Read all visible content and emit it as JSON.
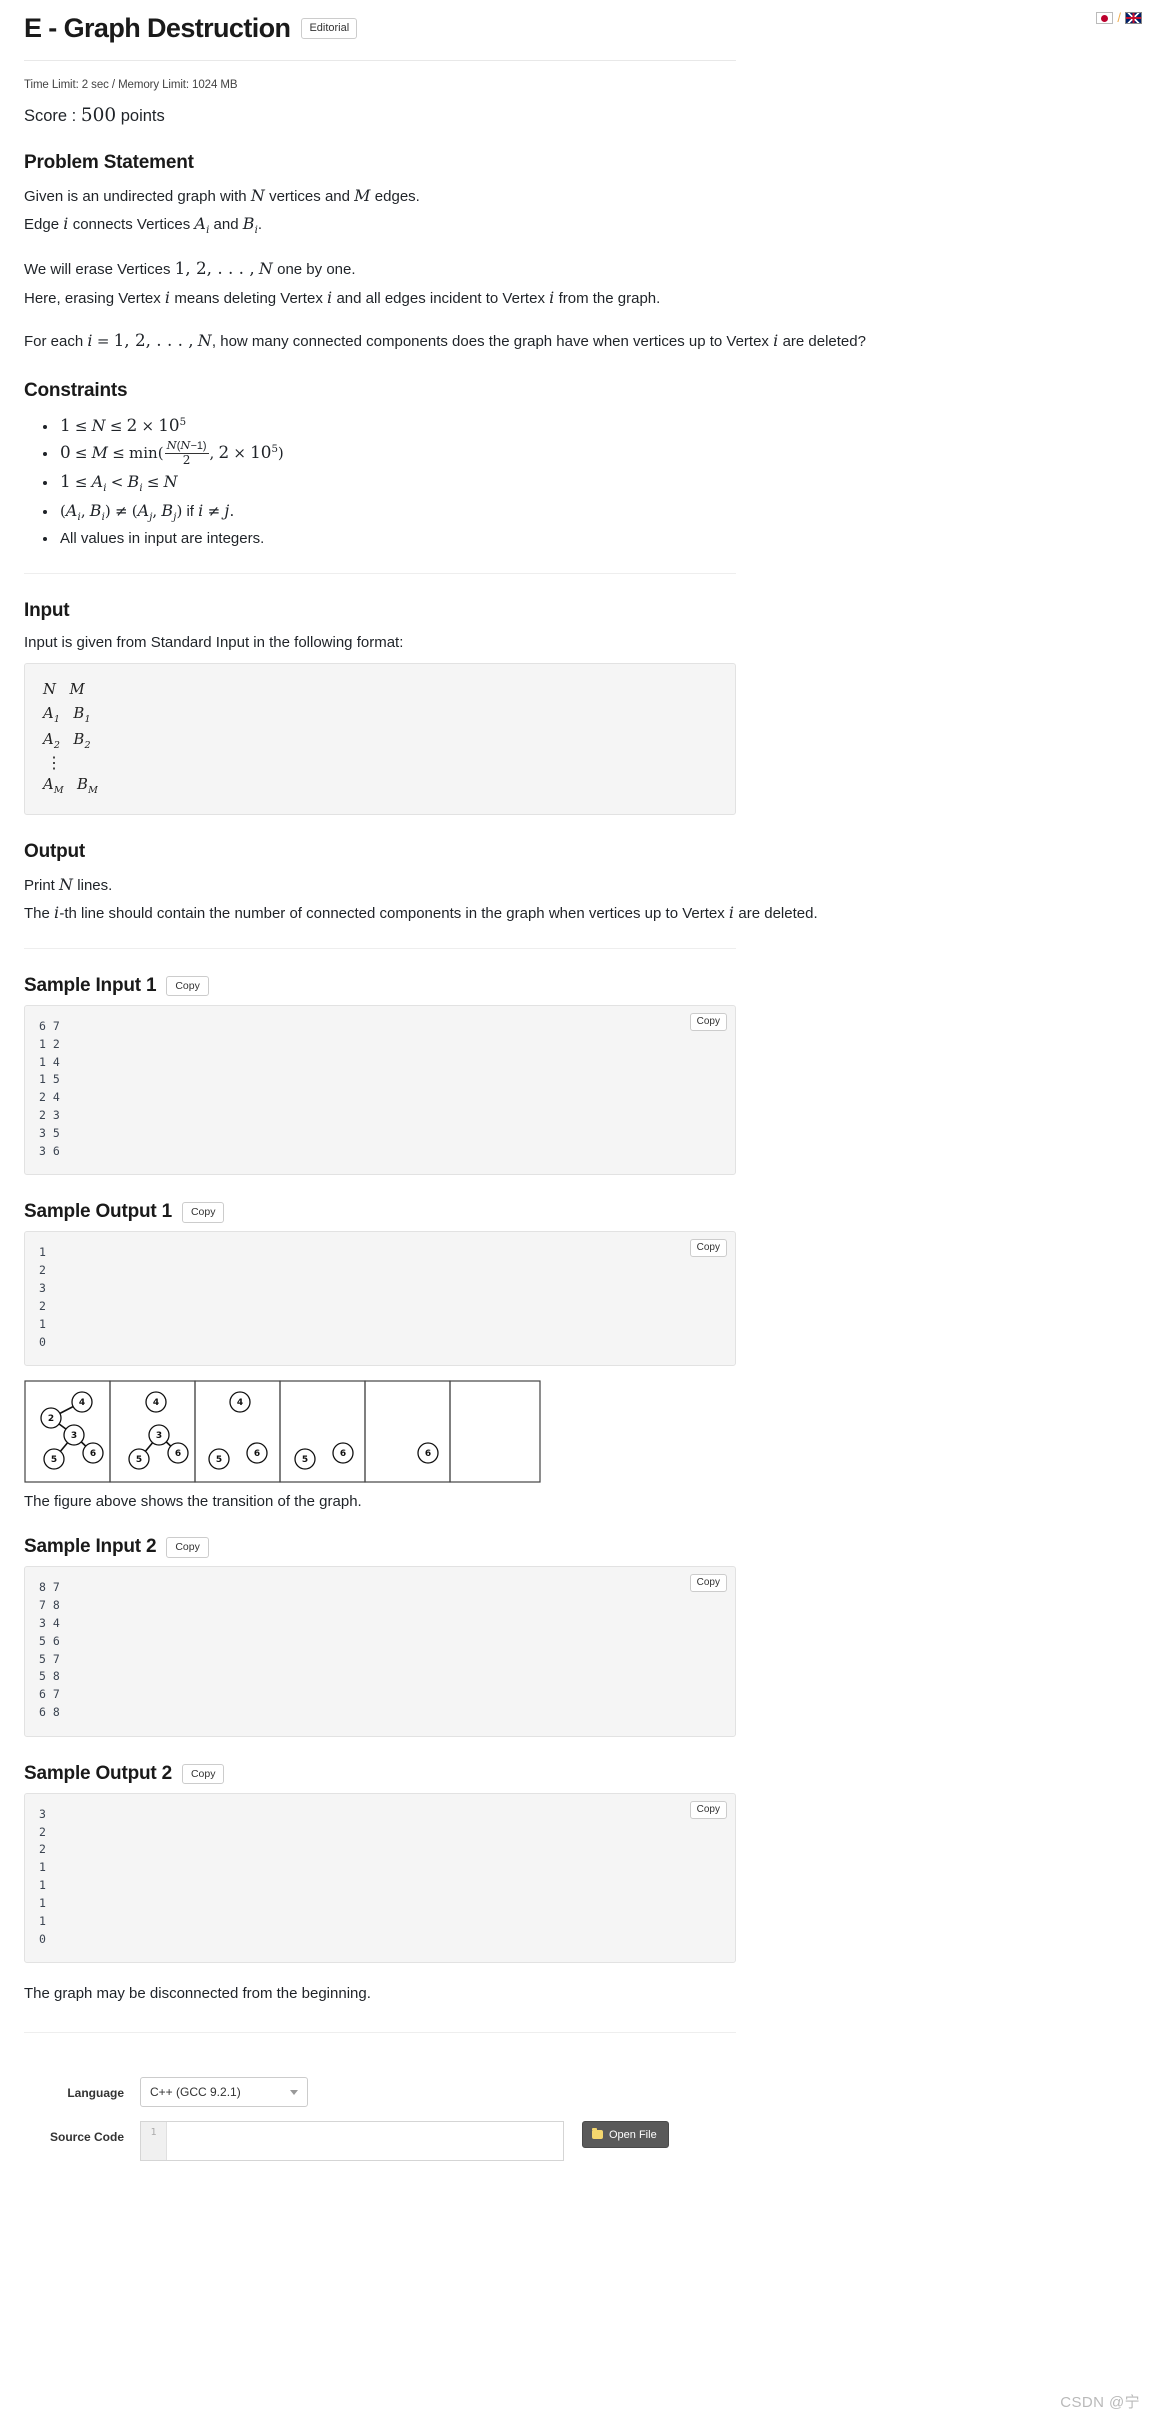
{
  "header": {
    "title": "E - Graph Destruction",
    "editorial_label": "Editorial",
    "lang_jp": "japanese-flag",
    "lang_separator": "/",
    "lang_en": "uk-flag"
  },
  "meta": {
    "limits": "Time Limit: 2 sec / Memory Limit: 1024 MB",
    "score_prefix": "Score :",
    "score_value": "500",
    "score_suffix": "points"
  },
  "problem_statement": {
    "heading": "Problem Statement",
    "line1_a": "Given is an undirected graph with",
    "line1_N": "N",
    "line1_b": "vertices and",
    "line1_M": "M",
    "line1_c": "edges.",
    "line2_a": "Edge",
    "line2_i": "i",
    "line2_b": "connects Vertices",
    "line2_A": "A",
    "line2_Asub": "i",
    "line2_c": "and",
    "line2_B": "B",
    "line2_Bsub": "i",
    "line2_d": ".",
    "line3_a": "We will erase Vertices",
    "line3_seq": "1, 2, . . . ,",
    "line3_N": "N",
    "line3_b": "one by one.",
    "line4_a": "Here, erasing Vertex",
    "line4_i1": "i",
    "line4_b": "means deleting Vertex",
    "line4_i2": "i",
    "line4_c": "and all edges incident to Vertex",
    "line4_i3": "i",
    "line4_d": "from the graph.",
    "line5_a": "For each",
    "line5_i": "i",
    "line5_eq": "=",
    "line5_seq": "1, 2, . . . ,",
    "line5_N": "N",
    "line5_b": ", how many connected components does the graph have when vertices up to Vertex",
    "line5_i2": "i",
    "line5_c": "are deleted?"
  },
  "constraints": {
    "heading": "Constraints",
    "items": [
      "1 <= N <= 2 x 10^5",
      "0 <= M <= min(N(N-1)/2, 2 x 10^5)",
      "1 <= A_i < B_i <= N",
      "(A_i, B_i) != (A_j, B_j) if i != j.",
      "All values in input are integers."
    ],
    "item5_text": "All values in input are integers."
  },
  "input_section": {
    "heading": "Input",
    "description": "Input is given from Standard Input in the following format:",
    "format_lines": [
      "N   M",
      "A₁   B₁",
      "A₂   B₂",
      "⋮",
      "A_M   B_M"
    ]
  },
  "output_section": {
    "heading": "Output",
    "line1_a": "Print",
    "line1_N": "N",
    "line1_b": "lines.",
    "line2_a": "The",
    "line2_i": "i",
    "line2_b": "-th line should contain the number of connected components in the graph when vertices up to Vertex",
    "line2_i2": "i",
    "line2_c": "are deleted."
  },
  "samples": [
    {
      "heading": "Sample Input 1",
      "copy_label": "Copy",
      "inner_copy_label": "Copy",
      "content": "6 7\n1 2\n1 4\n1 5\n2 4\n2 3\n3 5\n3 6"
    },
    {
      "heading": "Sample Output 1",
      "copy_label": "Copy",
      "inner_copy_label": "Copy",
      "content": "1\n2\n3\n2\n1\n0"
    },
    {
      "heading": "Sample Input 2",
      "copy_label": "Copy",
      "inner_copy_label": "Copy",
      "content": "8 7\n7 8\n3 4\n5 6\n5 7\n5 8\n6 7\n6 8"
    },
    {
      "heading": "Sample Output 2",
      "copy_label": "Copy",
      "inner_copy_label": "Copy",
      "content": "3\n2\n2\n1\n1\n1\n1\n0"
    }
  ],
  "figure": {
    "caption": "The figure above shows the transition of the graph.",
    "panels": [
      {
        "nodes": [
          "4",
          "2",
          "3",
          "5",
          "6"
        ],
        "edges": [
          [
            "2",
            "4"
          ],
          [
            "2",
            "3"
          ],
          [
            "3",
            "5"
          ],
          [
            "3",
            "6"
          ]
        ]
      },
      {
        "nodes": [
          "4",
          "3",
          "5",
          "6"
        ],
        "edges": [
          [
            "3",
            "5"
          ],
          [
            "3",
            "6"
          ]
        ]
      },
      {
        "nodes": [
          "4",
          "5",
          "6"
        ],
        "edges": []
      },
      {
        "nodes": [
          "5",
          "6"
        ],
        "edges": []
      },
      {
        "nodes": [
          "6"
        ],
        "edges": []
      },
      {
        "nodes": [],
        "edges": []
      }
    ]
  },
  "note2": "The graph may be disconnected from the beginning.",
  "submit_form": {
    "language_label": "Language",
    "language_value": "C++ (GCC 9.2.1)",
    "source_code_label": "Source Code",
    "line_number": "1",
    "open_file_label": "Open File"
  },
  "watermark": "CSDN @宁"
}
